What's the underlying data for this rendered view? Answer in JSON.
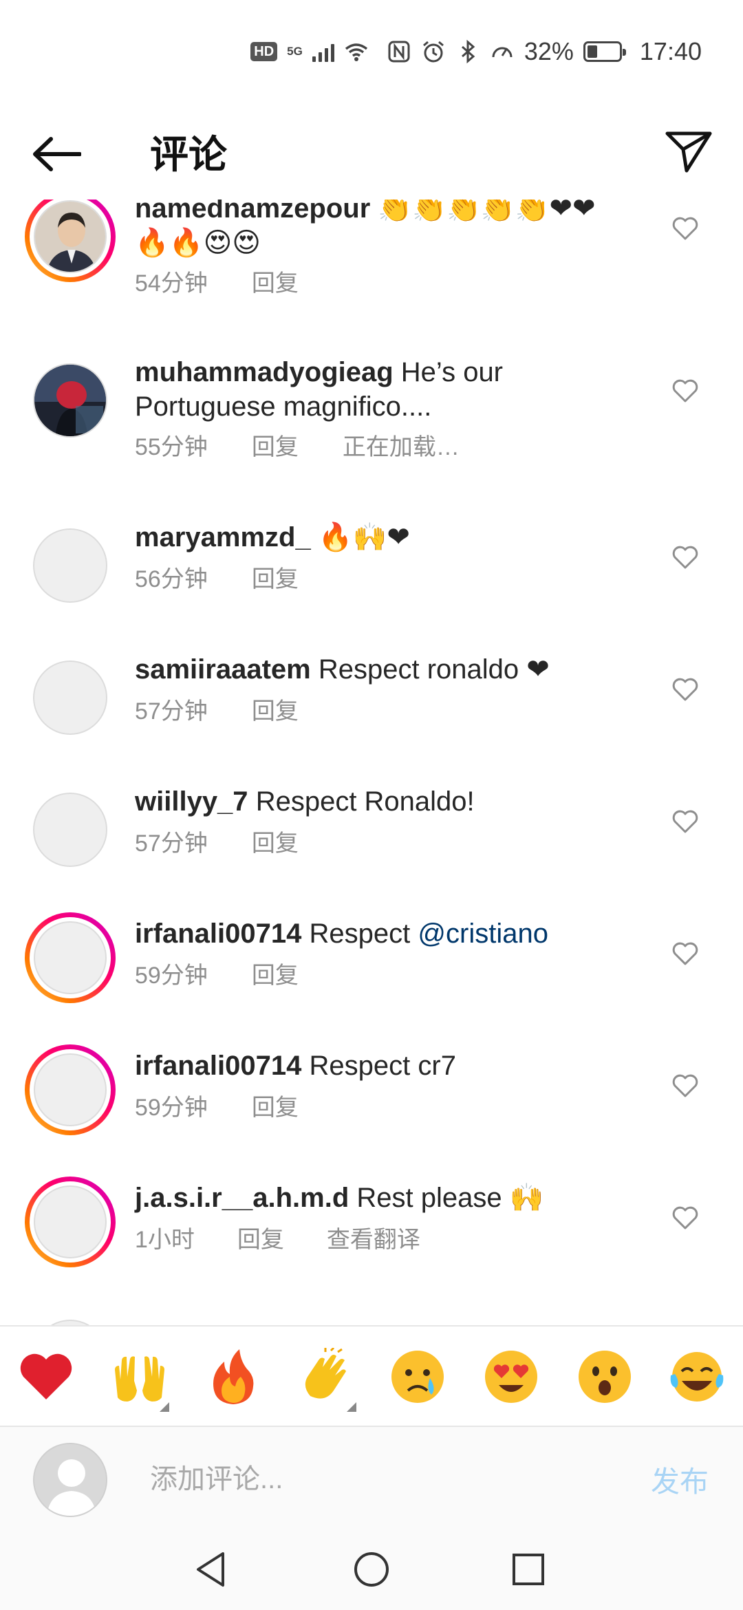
{
  "status_bar": {
    "hd": "HD",
    "net": "5G",
    "battery_text": "32%",
    "battery_level": 0.32,
    "time": "17:40"
  },
  "header": {
    "title": "评论"
  },
  "comments": [
    {
      "username": "namednamzepour",
      "text": "",
      "emoji_lines": [
        "👏👏👏👏👏❤❤",
        "🔥🔥😍😍"
      ],
      "time": "54分钟",
      "reply": "回复",
      "extra": "",
      "ring": true
    },
    {
      "username": "muhammadyogieag",
      "text": "He’s our Portuguese magnifico....",
      "time": "55分钟",
      "reply": "回复",
      "extra": "正在加载…",
      "ring": false
    },
    {
      "username": "maryammzd_",
      "text": "🔥🙌❤",
      "time": "56分钟",
      "reply": "回复",
      "extra": "",
      "ring": false
    },
    {
      "username": "samiiraaatem",
      "text": "Respect ronaldo ❤",
      "time": "57分钟",
      "reply": "回复",
      "extra": "",
      "ring": false
    },
    {
      "username": "wiillyy_7",
      "text": "Respect Ronaldo!",
      "time": "57分钟",
      "reply": "回复",
      "extra": "",
      "ring": false
    },
    {
      "username": "irfanali00714",
      "text": "Respect",
      "mention": "@cristiano",
      "time": "59分钟",
      "reply": "回复",
      "extra": "",
      "ring": true
    },
    {
      "username": "irfanali00714",
      "text": "Respect cr7",
      "time": "59分钟",
      "reply": "回复",
      "extra": "",
      "ring": true
    },
    {
      "username": "j.a.s.i.r__a.h.m.d",
      "text": "Rest please 🙌",
      "time": "1小时",
      "reply": "回复",
      "extra": "查看翻译",
      "ring": true
    }
  ],
  "reactions": [
    "❤",
    "🙌",
    "🔥",
    "👏",
    "😢",
    "😍",
    "😮",
    "😂"
  ],
  "input": {
    "placeholder": "添加评论...",
    "post_label": "发布"
  },
  "icons": {
    "back": "arrow-left-icon",
    "share": "paper-plane-icon",
    "heart": "heart-outline-icon",
    "nav_back": "triangle-back-icon",
    "nav_home": "circle-home-icon",
    "nav_recent": "square-recent-icon"
  },
  "colors": {
    "mention": "#00376b",
    "post_disabled": "#a9d4f5",
    "ring_start": "#d300c5",
    "ring_end": "#ffc34d"
  }
}
